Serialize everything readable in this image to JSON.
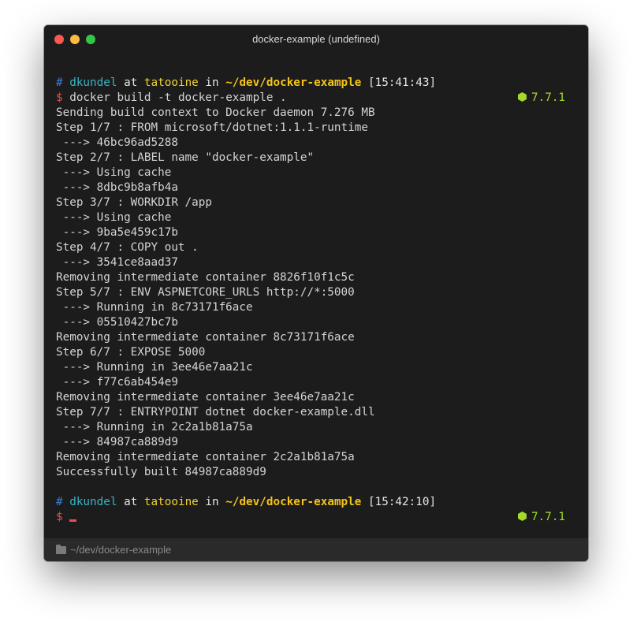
{
  "window": {
    "title": "docker-example (undefined)"
  },
  "prompt1": {
    "hash": "#",
    "user": "dkundel",
    "at": "at",
    "host": "tatooine",
    "in": "in",
    "path": "~/dev/docker-example",
    "time": "[15:41:43]",
    "dollar": "$",
    "command": "docker build -t docker-example .",
    "node_version": "7.7.1"
  },
  "output": [
    "Sending build context to Docker daemon 7.276 MB",
    "Step 1/7 : FROM microsoft/dotnet:1.1.1-runtime",
    " ---> 46bc96ad5288",
    "Step 2/7 : LABEL name \"docker-example\"",
    " ---> Using cache",
    " ---> 8dbc9b8afb4a",
    "Step 3/7 : WORKDIR /app",
    " ---> Using cache",
    " ---> 9ba5e459c17b",
    "Step 4/7 : COPY out .",
    " ---> 3541ce8aad37",
    "Removing intermediate container 8826f10f1c5c",
    "Step 5/7 : ENV ASPNETCORE_URLS http://*:5000",
    " ---> Running in 8c73171f6ace",
    " ---> 05510427bc7b",
    "Removing intermediate container 8c73171f6ace",
    "Step 6/7 : EXPOSE 5000",
    " ---> Running in 3ee46e7aa21c",
    " ---> f77c6ab454e9",
    "Removing intermediate container 3ee46e7aa21c",
    "Step 7/7 : ENTRYPOINT dotnet docker-example.dll",
    " ---> Running in 2c2a1b81a75a",
    " ---> 84987ca889d9",
    "Removing intermediate container 2c2a1b81a75a",
    "Successfully built 84987ca889d9"
  ],
  "prompt2": {
    "hash": "#",
    "user": "dkundel",
    "at": "at",
    "host": "tatooine",
    "in": "in",
    "path": "~/dev/docker-example",
    "time": "[15:42:10]",
    "dollar": "$",
    "node_version": "7.7.1"
  },
  "statusbar": {
    "path": "~/dev/docker-example",
    "icon": "folder-icon"
  },
  "colors": {
    "background": "#1c1c1c",
    "close": "#fc5753",
    "minimize": "#fdbc40",
    "maximize": "#33c748",
    "user": "#36b5c7",
    "host": "#f0d130",
    "path": "#f5c518",
    "dollar": "#f14c4c",
    "node": "#a6d92b"
  }
}
